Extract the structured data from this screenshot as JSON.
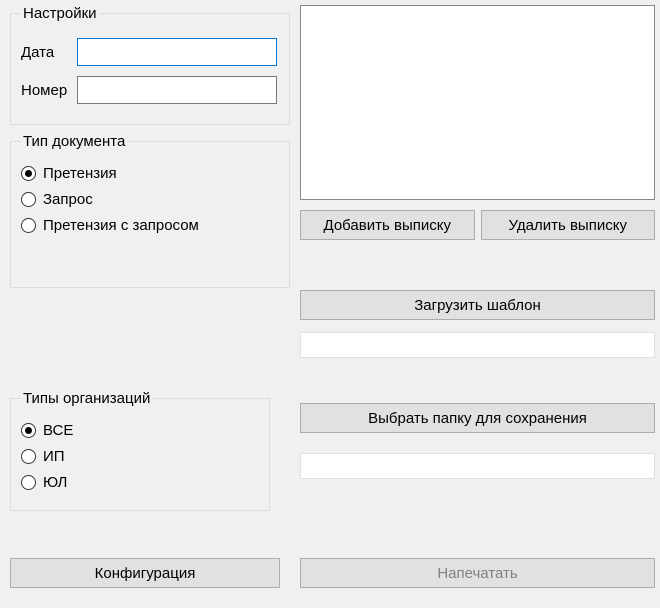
{
  "settings": {
    "legend": "Настройки",
    "date_label": "Дата",
    "date_value": "",
    "number_label": "Номер",
    "number_value": ""
  },
  "doc_type": {
    "legend": "Тип документа",
    "options": {
      "claim": "Претензия",
      "request": "Запрос",
      "claim_request": "Претензия с запросом"
    },
    "selected": "claim"
  },
  "org_type": {
    "legend": "Типы организаций",
    "options": {
      "all": "ВСЕ",
      "ip": "ИП",
      "ul": "ЮЛ"
    },
    "selected": "all"
  },
  "config_button": "Конфигурация",
  "right": {
    "add_extract": "Добавить выписку",
    "delete_extract": "Удалить выписку",
    "load_template": "Загрузить шаблон",
    "template_path": "",
    "choose_folder": "Выбрать папку для сохранения",
    "folder_path": "",
    "print": "Напечатать"
  }
}
